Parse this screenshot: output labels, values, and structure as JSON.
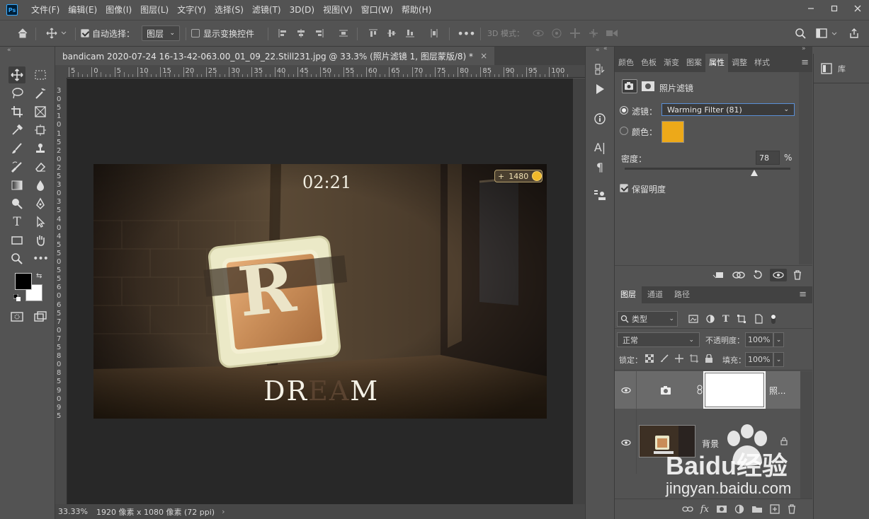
{
  "app": {
    "logo": "Ps"
  },
  "menu": [
    "文件(F)",
    "编辑(E)",
    "图像(I)",
    "图层(L)",
    "文字(Y)",
    "选择(S)",
    "滤镜(T)",
    "3D(D)",
    "视图(V)",
    "窗口(W)",
    "帮助(H)"
  ],
  "options": {
    "auto_select_label": "自动选择：",
    "auto_select_value": "图层",
    "transform_controls_label": "显示变换控件",
    "mode_3d_label": "3D 模式："
  },
  "document": {
    "tab_title": "bandicam 2020-07-24 16-13-42-063.00_01_09_22.Still231.jpg @ 33.3% (照片滤镜 1, 图层蒙版/8) *",
    "hruler_ticks": [
      "5",
      "0",
      "5",
      "10",
      "15",
      "20",
      "25",
      "30",
      "35",
      "40",
      "45",
      "50",
      "55",
      "60",
      "65",
      "70",
      "75",
      "80",
      "85",
      "90",
      "95",
      "100"
    ],
    "vruler_digits": [
      "3",
      "0",
      "5",
      "1",
      "0",
      "1",
      "5",
      "2",
      "0",
      "2",
      "5",
      "3",
      "0",
      "3",
      "5",
      "4",
      "0",
      "4",
      "5",
      "5",
      "0",
      "5",
      "5",
      "6",
      "0",
      "6",
      "5",
      "7",
      "0",
      "7",
      "5",
      "8",
      "0",
      "8",
      "5",
      "9",
      "0",
      "9",
      "5"
    ]
  },
  "image": {
    "timer": "02:21",
    "coins": "1480",
    "block_letter": "R",
    "word_a": "DR",
    "word_b": "EA",
    "word_c": "M"
  },
  "status": {
    "zoom": "33.33%",
    "info": "1920 像素 x 1080 像素 (72 ppi)"
  },
  "properties": {
    "tabs": [
      "颜色",
      "色板",
      "渐变",
      "图案",
      "属性",
      "调整",
      "样式"
    ],
    "active_tab": "属性",
    "title": "照片滤镜",
    "filter_label": "滤镜：",
    "filter_value": "Warming Filter (81)",
    "color_label": "颜色：",
    "color_value": "#EDA919",
    "density_label": "密度：",
    "density_value": "78",
    "density_unit": "%",
    "density_fraction": 0.78,
    "preserve_label": "保留明度"
  },
  "layers": {
    "tabs": [
      "图层",
      "通道",
      "路径"
    ],
    "kind_label": "类型",
    "blend_mode": "正常",
    "opacity_label": "不透明度：",
    "opacity_value": "100%",
    "lock_label": "锁定：",
    "fill_label": "填充：",
    "fill_value": "100%",
    "items": [
      {
        "name": "照...",
        "type": "adjustment"
      },
      {
        "name": "背景",
        "type": "image"
      }
    ]
  },
  "library": {
    "label": "库"
  },
  "watermark": {
    "brand": "Baidu经验",
    "url": "jingyan.baidu.com"
  }
}
